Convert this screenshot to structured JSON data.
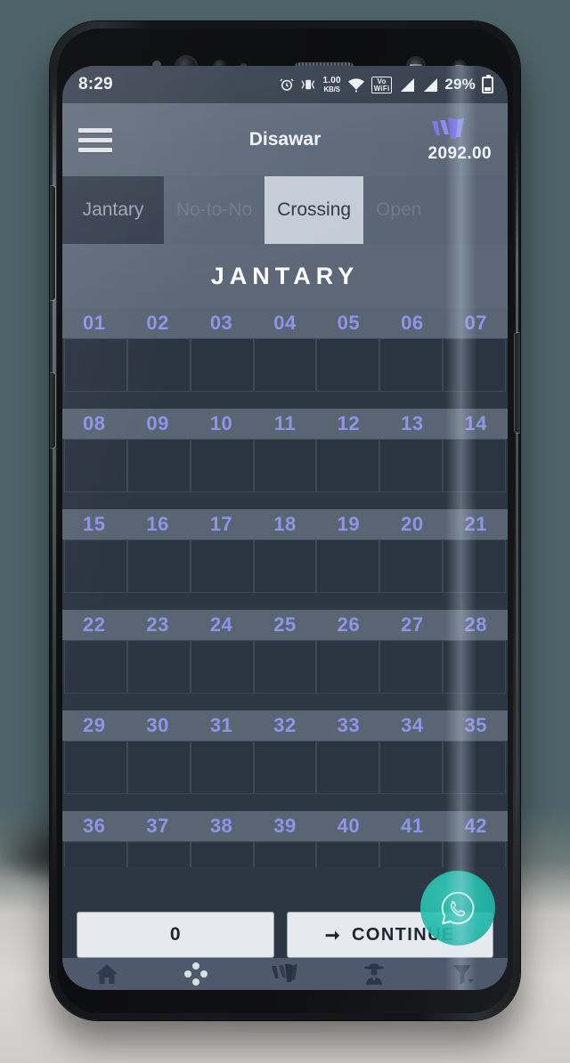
{
  "device": {
    "frame": "samsung-galaxy-phone"
  },
  "status_bar": {
    "time": "8:29",
    "alarm_icon": "alarm-clock-icon",
    "bluetooth_vibrate_icon": "bluetooth-vibrate-icon",
    "data_rate": "1.00",
    "data_rate_unit": "KB/S",
    "wifi_icon": "wifi-icon",
    "vowifi_label": "Vo",
    "vowifi_sub": "WiFi",
    "vowifi_slot": "1",
    "signal_icon_1": "signal-bars-icon",
    "signal_icon_2": "signal-bars-icon",
    "battery_percent": "29%",
    "battery_icon": "battery-icon"
  },
  "app_bar": {
    "menu_icon": "hamburger-menu-icon",
    "title": "Disawar",
    "wallet_icon": "wallet-w-logo-icon",
    "wallet_balance": "2092.00",
    "wallet_color": "#7b76e8"
  },
  "tabs": [
    {
      "label": "Jantary",
      "state": "first"
    },
    {
      "label": "No-to-No",
      "state": "plain"
    },
    {
      "label": "Crossing",
      "state": "active"
    },
    {
      "label": "Open",
      "state": "plain"
    }
  ],
  "section": {
    "title": "JANTARY"
  },
  "grid": {
    "number_color": "#8e95e6",
    "rows": [
      {
        "labels": [
          "01",
          "02",
          "03",
          "04",
          "05",
          "06",
          "07"
        ],
        "values": [
          "",
          "",
          "",
          "",
          "",
          "",
          ""
        ]
      },
      {
        "labels": [
          "08",
          "09",
          "10",
          "11",
          "12",
          "13",
          "14"
        ],
        "values": [
          "",
          "",
          "",
          "",
          "",
          "",
          ""
        ]
      },
      {
        "labels": [
          "15",
          "16",
          "17",
          "18",
          "19",
          "20",
          "21"
        ],
        "values": [
          "",
          "",
          "",
          "",
          "",
          "",
          ""
        ]
      },
      {
        "labels": [
          "22",
          "23",
          "24",
          "25",
          "26",
          "27",
          "28"
        ],
        "values": [
          "",
          "",
          "",
          "",
          "",
          "",
          ""
        ]
      },
      {
        "labels": [
          "29",
          "30",
          "31",
          "32",
          "33",
          "34",
          "35"
        ],
        "values": [
          "",
          "",
          "",
          "",
          "",
          "",
          ""
        ]
      },
      {
        "labels": [
          "36",
          "37",
          "38",
          "39",
          "40",
          "41",
          "42"
        ],
        "values": [
          "",
          "",
          "",
          "",
          "",
          "",
          ""
        ]
      }
    ]
  },
  "actions": {
    "amount_value": "0",
    "amount_placeholder": "0",
    "continue_label": "CONTINUE",
    "continue_arrow_icon": "arrow-right-icon"
  },
  "fab": {
    "icon": "whatsapp-icon",
    "color": "#22b8aa"
  },
  "bottom_nav": [
    {
      "icon": "home-icon",
      "name": "nav-home"
    },
    {
      "icon": "dice-dots-icon",
      "name": "nav-games"
    },
    {
      "icon": "wallet-w-icon",
      "name": "nav-wallet"
    },
    {
      "icon": "detective-icon",
      "name": "nav-agent"
    },
    {
      "icon": "funnel-icon",
      "name": "nav-filter"
    }
  ]
}
